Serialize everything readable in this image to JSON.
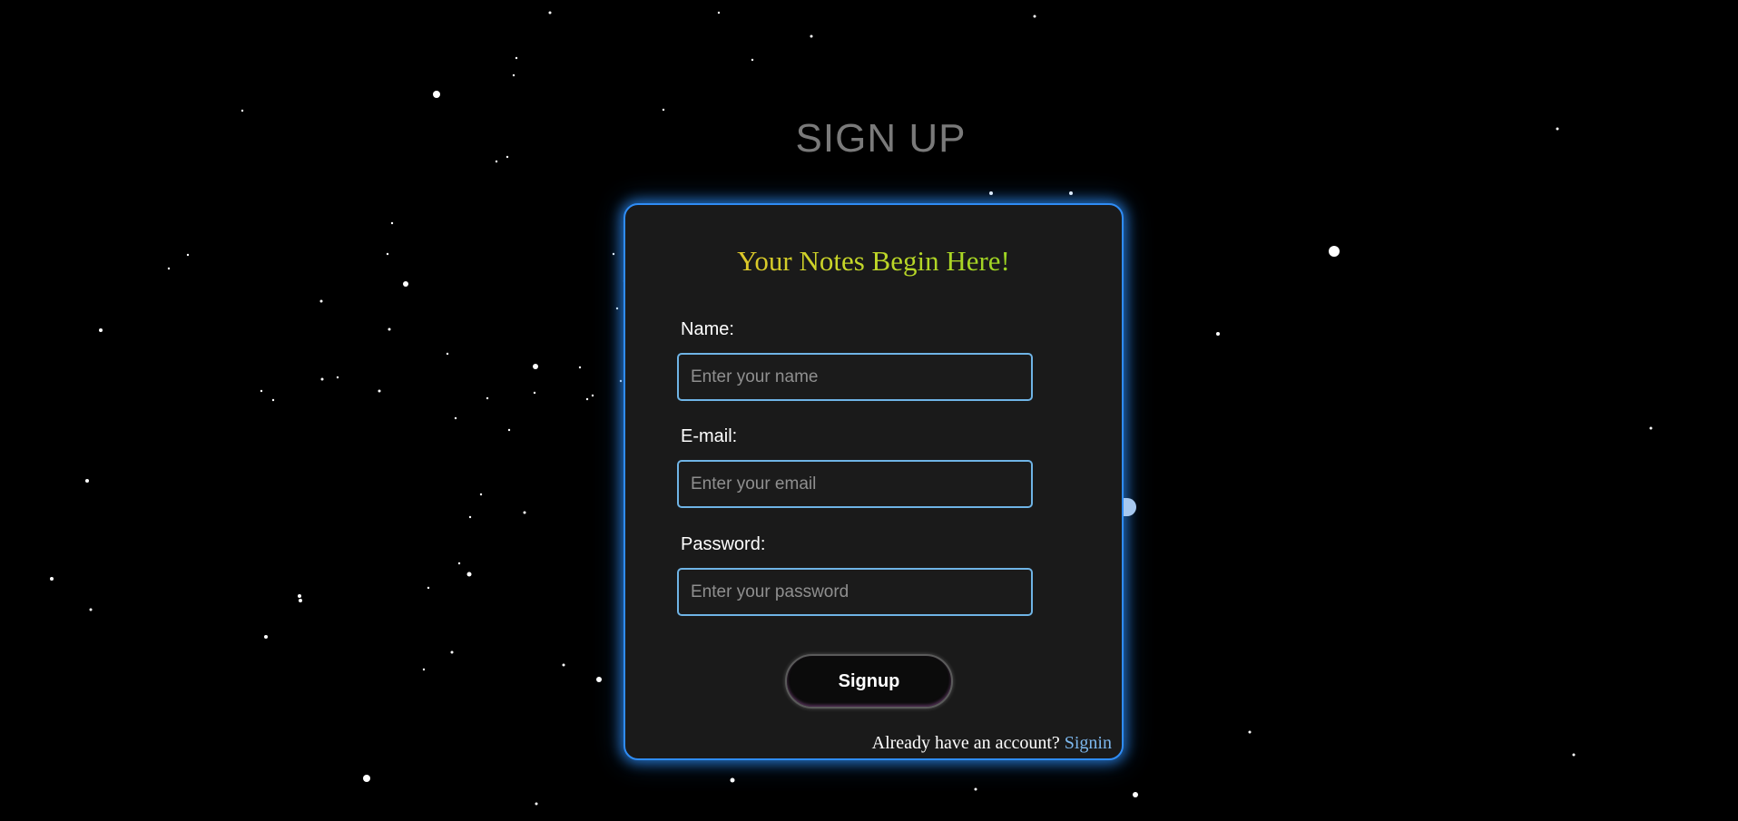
{
  "page": {
    "title": "SIGN UP",
    "background_color": "#000000",
    "star_color": "#ffffff"
  },
  "card": {
    "border_color": "#2f8cf5",
    "tagline": "Your Notes Begin Here!",
    "tagline_gradient": [
      "#f5b52a",
      "#c7d829",
      "#7fd21f"
    ]
  },
  "form": {
    "name": {
      "label": "Name:",
      "placeholder": "Enter your name",
      "value": ""
    },
    "email": {
      "label": "E-mail:",
      "placeholder": "Enter your email",
      "value": ""
    },
    "password": {
      "label": "Password:",
      "placeholder": "Enter your password",
      "value": ""
    },
    "submit_label": "Signup"
  },
  "footer": {
    "prompt": "Already have an account?",
    "link_label": "Signin",
    "link_color": "#7db8ee"
  }
}
